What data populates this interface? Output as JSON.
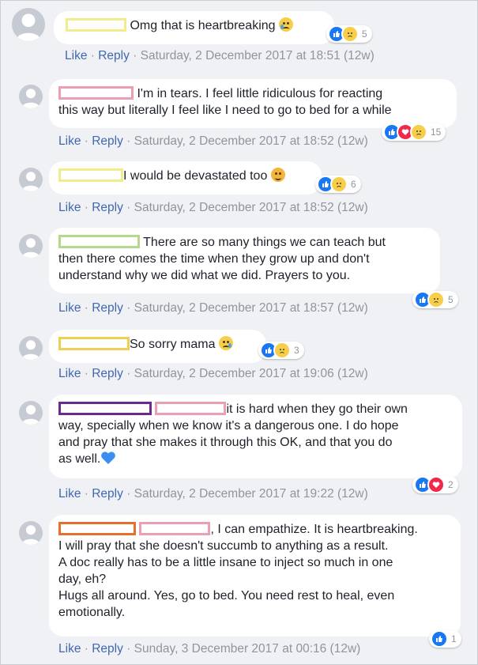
{
  "colors": {
    "like_blue": "#1877f2",
    "love_red": "#f0284a",
    "sad_yellow": "#f7ce4a",
    "link": "#4267b2",
    "meta": "#90949c",
    "redact_yellow": "#f1ec8c",
    "redact_pink": "#ec9fb3",
    "redact_green": "#b5d98c",
    "redact_gold": "#efce56",
    "redact_purple": "#6a2a8e",
    "redact_orange": "#e76f2e"
  },
  "labels": {
    "like": "Like",
    "reply": "Reply",
    "dot": "·"
  },
  "comments": [
    {
      "text": "Omg that is heartbreaking",
      "emoji_name": "crying-face-icon",
      "reactions": [
        "like",
        "sad"
      ],
      "reaction_count": "5",
      "timestamp": "Saturday, 2 December 2017 at 18:51 (12w)"
    },
    {
      "line1": "I'm in tears. I feel little ridiculous for reacting",
      "line2": "this way but literally I feel like I need to go to bed for a while",
      "reactions": [
        "like",
        "love",
        "sad"
      ],
      "reaction_count": "15",
      "timestamp": "Saturday, 2 December 2017 at 18:52 (12w)"
    },
    {
      "text": "I would be devastated too",
      "emoji_name": "tired-face-icon",
      "reactions": [
        "like",
        "sad"
      ],
      "reaction_count": "6",
      "timestamp": "Saturday, 2 December 2017 at 18:52 (12w)"
    },
    {
      "line1": "There are so many things we can teach but",
      "line2": "then there comes the time when they grow up and don't",
      "line3": "understand why we did what we did. Prayers to you.",
      "reactions": [
        "like",
        "sad"
      ],
      "reaction_count": "5",
      "timestamp": "Saturday, 2 December 2017 at 18:57 (12w)"
    },
    {
      "text": "So sorry mama",
      "emoji_name": "sad-tear-face-icon",
      "reactions": [
        "like",
        "sad"
      ],
      "reaction_count": "3",
      "timestamp": "Saturday, 2 December 2017 at 19:06 (12w)"
    },
    {
      "line1": "it is hard when they go their own",
      "line2": "way, specially when we know it's a dangerous one. I do hope",
      "line3": "and pray that she makes it through this OK, and that you do",
      "line4": "as well.",
      "emoji_name": "blue-heart-icon",
      "reactions": [
        "like",
        "love"
      ],
      "reaction_count": "2",
      "timestamp": "Saturday, 2 December 2017 at 19:22 (12w)"
    },
    {
      "line1": ", I can empathize. It is heartbreaking.",
      "line2": "I will pray that she doesn't succumb to anything as a result.",
      "line3": "A doc really has to be a little insane to inject so much in one",
      "line4": "day, eh?",
      "line5": "Hugs all around. Yes, go to bed. You need rest to heal, even",
      "line6": "emotionally.",
      "reactions": [
        "like"
      ],
      "reaction_count": "1",
      "timestamp": "Sunday, 3 December 2017 at 00:16 (12w)"
    }
  ]
}
